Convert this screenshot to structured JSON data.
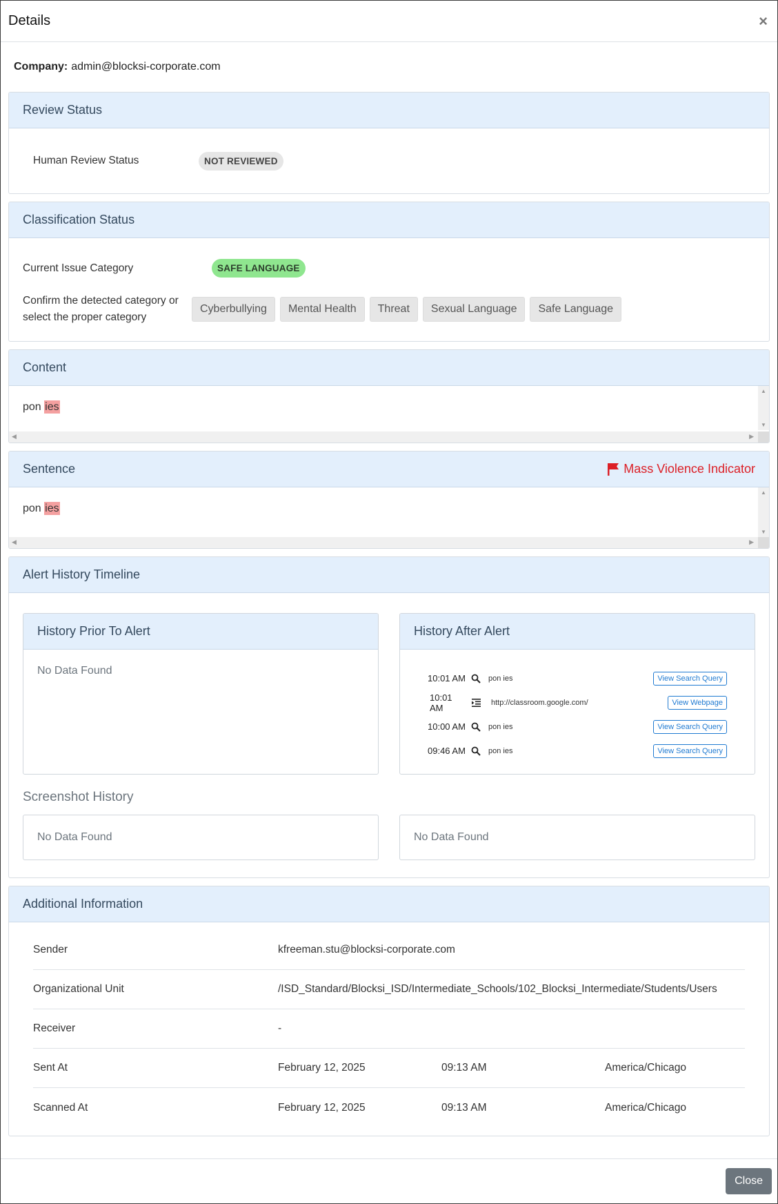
{
  "modal": {
    "title": "Details",
    "close_glyph": "×"
  },
  "company": {
    "label": "Company:",
    "value": "admin@blocksi-corporate.com"
  },
  "review": {
    "title": "Review Status",
    "label": "Human Review Status",
    "status": "NOT REVIEWED"
  },
  "classification": {
    "title": "Classification Status",
    "current_label": "Current Issue Category",
    "current_value": "SAFE LANGUAGE",
    "confirm_label": "Confirm the detected category or select the proper category",
    "categories": [
      "Cyberbullying",
      "Mental Health",
      "Threat",
      "Sexual Language",
      "Safe Language"
    ]
  },
  "content": {
    "title": "Content",
    "text_plain": "pon",
    "text_highlight": "ies"
  },
  "sentence": {
    "title": "Sentence",
    "indicator": "Mass Violence Indicator",
    "indicator_color": "#dc1f26",
    "text_plain": "pon",
    "text_highlight": "ies"
  },
  "timeline": {
    "title": "Alert History Timeline",
    "prior": {
      "title": "History Prior To Alert",
      "empty": "No Data Found"
    },
    "after": {
      "title": "History After Alert",
      "items": [
        {
          "time": "10:01 AM",
          "icon": "search-icon",
          "text": "pon ies",
          "button": "View Search Query"
        },
        {
          "time": "10:01 AM",
          "icon": "indent-icon",
          "text": "http://classroom.google.com/",
          "button": "View Webpage"
        },
        {
          "time": "10:00 AM",
          "icon": "search-icon",
          "text": "pon ies",
          "button": "View Search Query"
        },
        {
          "time": "09:46 AM",
          "icon": "search-icon",
          "text": "pon ies",
          "button": "View Search Query"
        }
      ]
    },
    "screenshot_title": "Screenshot History",
    "screenshot_left_empty": "No Data Found",
    "screenshot_right_empty": "No Data Found"
  },
  "additional": {
    "title": "Additional Information",
    "sender_label": "Sender",
    "sender_value": "kfreeman.stu@blocksi-corporate.com",
    "ou_label": "Organizational Unit",
    "ou_value": "/ISD_Standard/Blocksi_ISD/Intermediate_Schools/102_Blocksi_Intermediate/Students/Users",
    "receiver_label": "Receiver",
    "receiver_value": "-",
    "sent_label": "Sent At",
    "sent_date": "February 12, 2025",
    "sent_time": "09:13 AM",
    "sent_tz": "America/Chicago",
    "scanned_label": "Scanned At",
    "scanned_date": "February 12, 2025",
    "scanned_time": "09:13 AM",
    "scanned_tz": "America/Chicago"
  },
  "footer": {
    "close_label": "Close"
  }
}
